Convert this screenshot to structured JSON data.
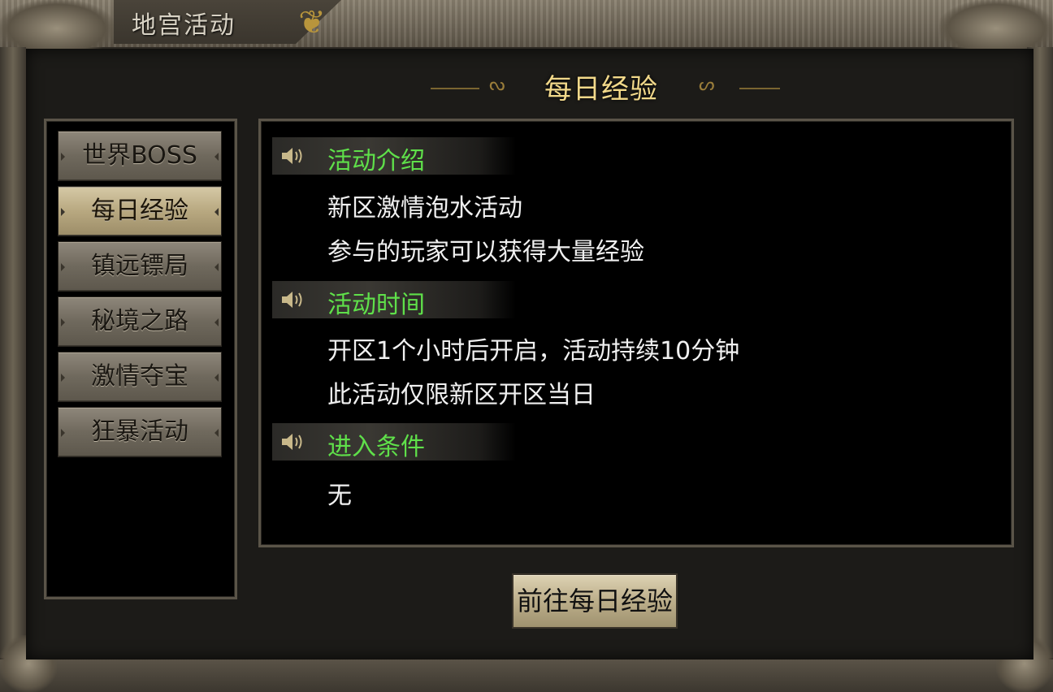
{
  "window": {
    "title": "地宫活动",
    "heading": "每日经验",
    "heading_ornament_icon": "swirl-ornament"
  },
  "sidebar": {
    "items": [
      {
        "label": "世界BOSS",
        "active": false
      },
      {
        "label": "每日经验",
        "active": true
      },
      {
        "label": "镇远镖局",
        "active": false
      },
      {
        "label": "秘境之路",
        "active": false
      },
      {
        "label": "激情夺宝",
        "active": false
      },
      {
        "label": "狂暴活动",
        "active": false
      }
    ]
  },
  "content": {
    "sections": [
      {
        "icon": "speaker-icon",
        "title": "活动介绍",
        "lines": [
          "新区激情泡水活动",
          "参与的玩家可以获得大量经验"
        ]
      },
      {
        "icon": "speaker-icon",
        "title": "活动时间",
        "lines": [
          "开区1个小时后开启，活动持续10分钟",
          "此活动仅限新区开区当日"
        ]
      },
      {
        "icon": "speaker-icon",
        "title": "进入条件",
        "lines": [
          "无"
        ]
      }
    ]
  },
  "actions": {
    "go_label": "前往每日经验"
  },
  "colors": {
    "section_title": "#5fe04a",
    "heading": "#f2d98a",
    "body_text": "#f0f0f0",
    "active_tab": "#d6c9a6"
  }
}
